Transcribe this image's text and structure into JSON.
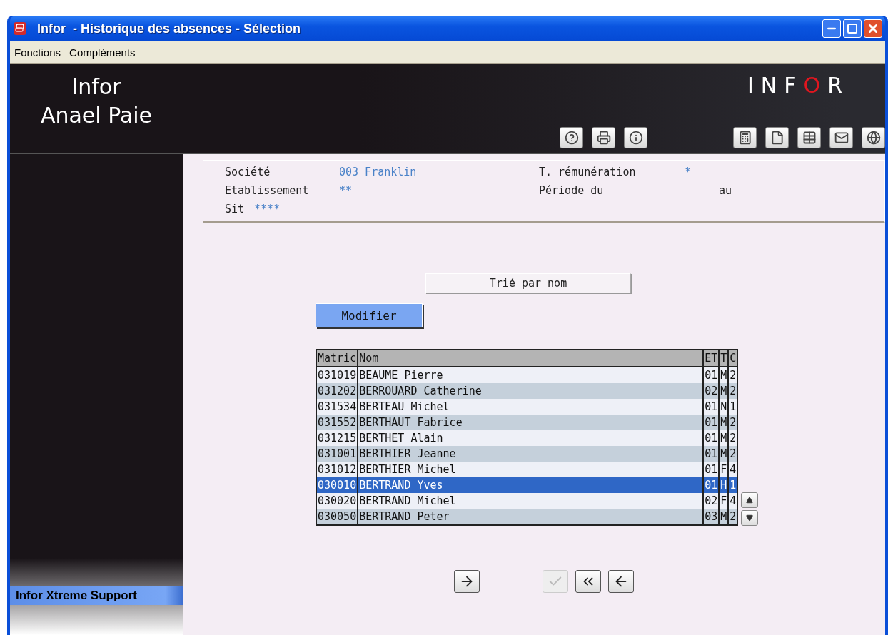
{
  "window": {
    "title": "Infor  - Historique des absences - Sélection"
  },
  "menu": [
    "Fonctions",
    "Compléments"
  ],
  "header": {
    "product_lines": [
      "Infor",
      "Anael Paie"
    ],
    "logo": [
      {
        "text": "INF",
        "color": "#ffffff"
      },
      {
        "text": "O",
        "color": "#e0161f"
      },
      {
        "text": "R",
        "color": "#ffffff"
      }
    ]
  },
  "sidebar": {
    "support_link": "Infor Xtreme Support"
  },
  "criteria": {
    "rows": [
      [
        {
          "label": "Société",
          "value": "003  Franklin"
        },
        {
          "label": "T. rémunération",
          "value": "*"
        }
      ],
      [
        {
          "label": "Etablissement",
          "value": "**"
        },
        {
          "label": "Période du",
          "suffix": "au"
        }
      ],
      [
        {
          "label": "Sit",
          "value": "****"
        }
      ]
    ]
  },
  "sort_label": "Trié par nom",
  "modify_button": "Modifier",
  "table": {
    "columns": [
      "Matric",
      "Nom",
      "ET",
      "T",
      "C"
    ],
    "rows": [
      {
        "cells": [
          "031019",
          "BEAUME Pierre",
          "01",
          "M",
          "2"
        ],
        "selected": false
      },
      {
        "cells": [
          "031202",
          "BERROUARD Catherine",
          "02",
          "M",
          "2"
        ],
        "selected": false
      },
      {
        "cells": [
          "031534",
          "BERTEAU Michel",
          "01",
          "N",
          "1"
        ],
        "selected": false
      },
      {
        "cells": [
          "031552",
          "BERTHAUT Fabrice",
          "01",
          "M",
          "2"
        ],
        "selected": false
      },
      {
        "cells": [
          "031215",
          "BERTHET Alain",
          "01",
          "M",
          "2"
        ],
        "selected": false
      },
      {
        "cells": [
          "031001",
          "BERTHIER Jeanne",
          "01",
          "M",
          "2"
        ],
        "selected": false
      },
      {
        "cells": [
          "031012",
          "BERTHIER Michel",
          "01",
          "F",
          "4"
        ],
        "selected": false
      },
      {
        "cells": [
          "030010",
          "BERTRAND Yves",
          "01",
          "H",
          "1"
        ],
        "selected": true
      },
      {
        "cells": [
          "030020",
          "BERTRAND Michel",
          "02",
          "F",
          "4"
        ],
        "selected": false
      },
      {
        "cells": [
          "030050",
          "BERTRAND Peter",
          "03",
          "M",
          "2"
        ],
        "selected": false
      }
    ]
  },
  "nav_buttons": [
    {
      "kind": "next",
      "disabled": false
    },
    {
      "kind": "validate",
      "disabled": true
    },
    {
      "kind": "first",
      "disabled": false
    },
    {
      "kind": "back",
      "disabled": false
    }
  ]
}
